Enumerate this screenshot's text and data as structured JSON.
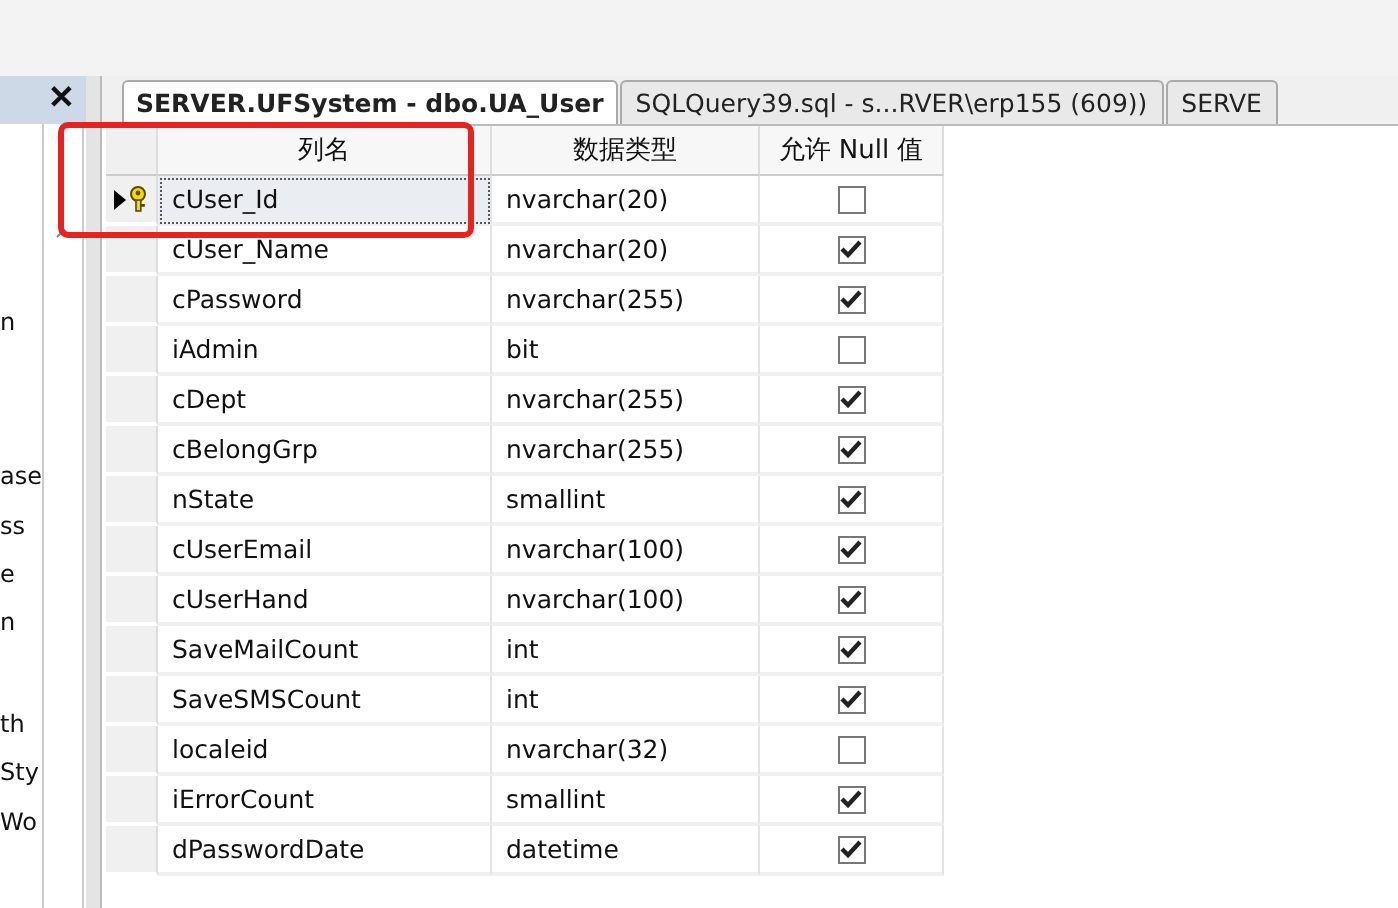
{
  "left_panel": {
    "close_button": "✕",
    "items": [
      "n",
      "ase",
      "ss",
      "e",
      "n",
      "th",
      "Sty",
      "Wo"
    ]
  },
  "tabs": [
    {
      "label": "SERVER.UFSystem - dbo.UA_User",
      "selected": true
    },
    {
      "label": "SQLQuery39.sql - s...RVER\\erp155 (609))",
      "selected": false
    },
    {
      "label": "SERVE",
      "selected": false
    }
  ],
  "table": {
    "columns": [
      "列名",
      "数据类型",
      "允许 Null 值"
    ],
    "rows": [
      {
        "name": "cUser_Id",
        "type": "nvarchar(20)",
        "allow_null": false,
        "primary_key": true,
        "selected": true
      },
      {
        "name": "cUser_Name",
        "type": "nvarchar(20)",
        "allow_null": true,
        "primary_key": false,
        "selected": false
      },
      {
        "name": "cPassword",
        "type": "nvarchar(255)",
        "allow_null": true,
        "primary_key": false,
        "selected": false
      },
      {
        "name": "iAdmin",
        "type": "bit",
        "allow_null": false,
        "primary_key": false,
        "selected": false
      },
      {
        "name": "cDept",
        "type": "nvarchar(255)",
        "allow_null": true,
        "primary_key": false,
        "selected": false
      },
      {
        "name": "cBelongGrp",
        "type": "nvarchar(255)",
        "allow_null": true,
        "primary_key": false,
        "selected": false
      },
      {
        "name": "nState",
        "type": "smallint",
        "allow_null": true,
        "primary_key": false,
        "selected": false
      },
      {
        "name": "cUserEmail",
        "type": "nvarchar(100)",
        "allow_null": true,
        "primary_key": false,
        "selected": false
      },
      {
        "name": "cUserHand",
        "type": "nvarchar(100)",
        "allow_null": true,
        "primary_key": false,
        "selected": false
      },
      {
        "name": "SaveMailCount",
        "type": "int",
        "allow_null": true,
        "primary_key": false,
        "selected": false
      },
      {
        "name": "SaveSMSCount",
        "type": "int",
        "allow_null": true,
        "primary_key": false,
        "selected": false
      },
      {
        "name": "localeid",
        "type": "nvarchar(32)",
        "allow_null": false,
        "primary_key": false,
        "selected": false
      },
      {
        "name": "iErrorCount",
        "type": "smallint",
        "allow_null": true,
        "primary_key": false,
        "selected": false
      },
      {
        "name": "dPasswordDate",
        "type": "datetime",
        "allow_null": true,
        "primary_key": false,
        "selected": false
      }
    ]
  },
  "annotation": {
    "kind": "highlight-rectangle",
    "color": "#e8231e"
  }
}
